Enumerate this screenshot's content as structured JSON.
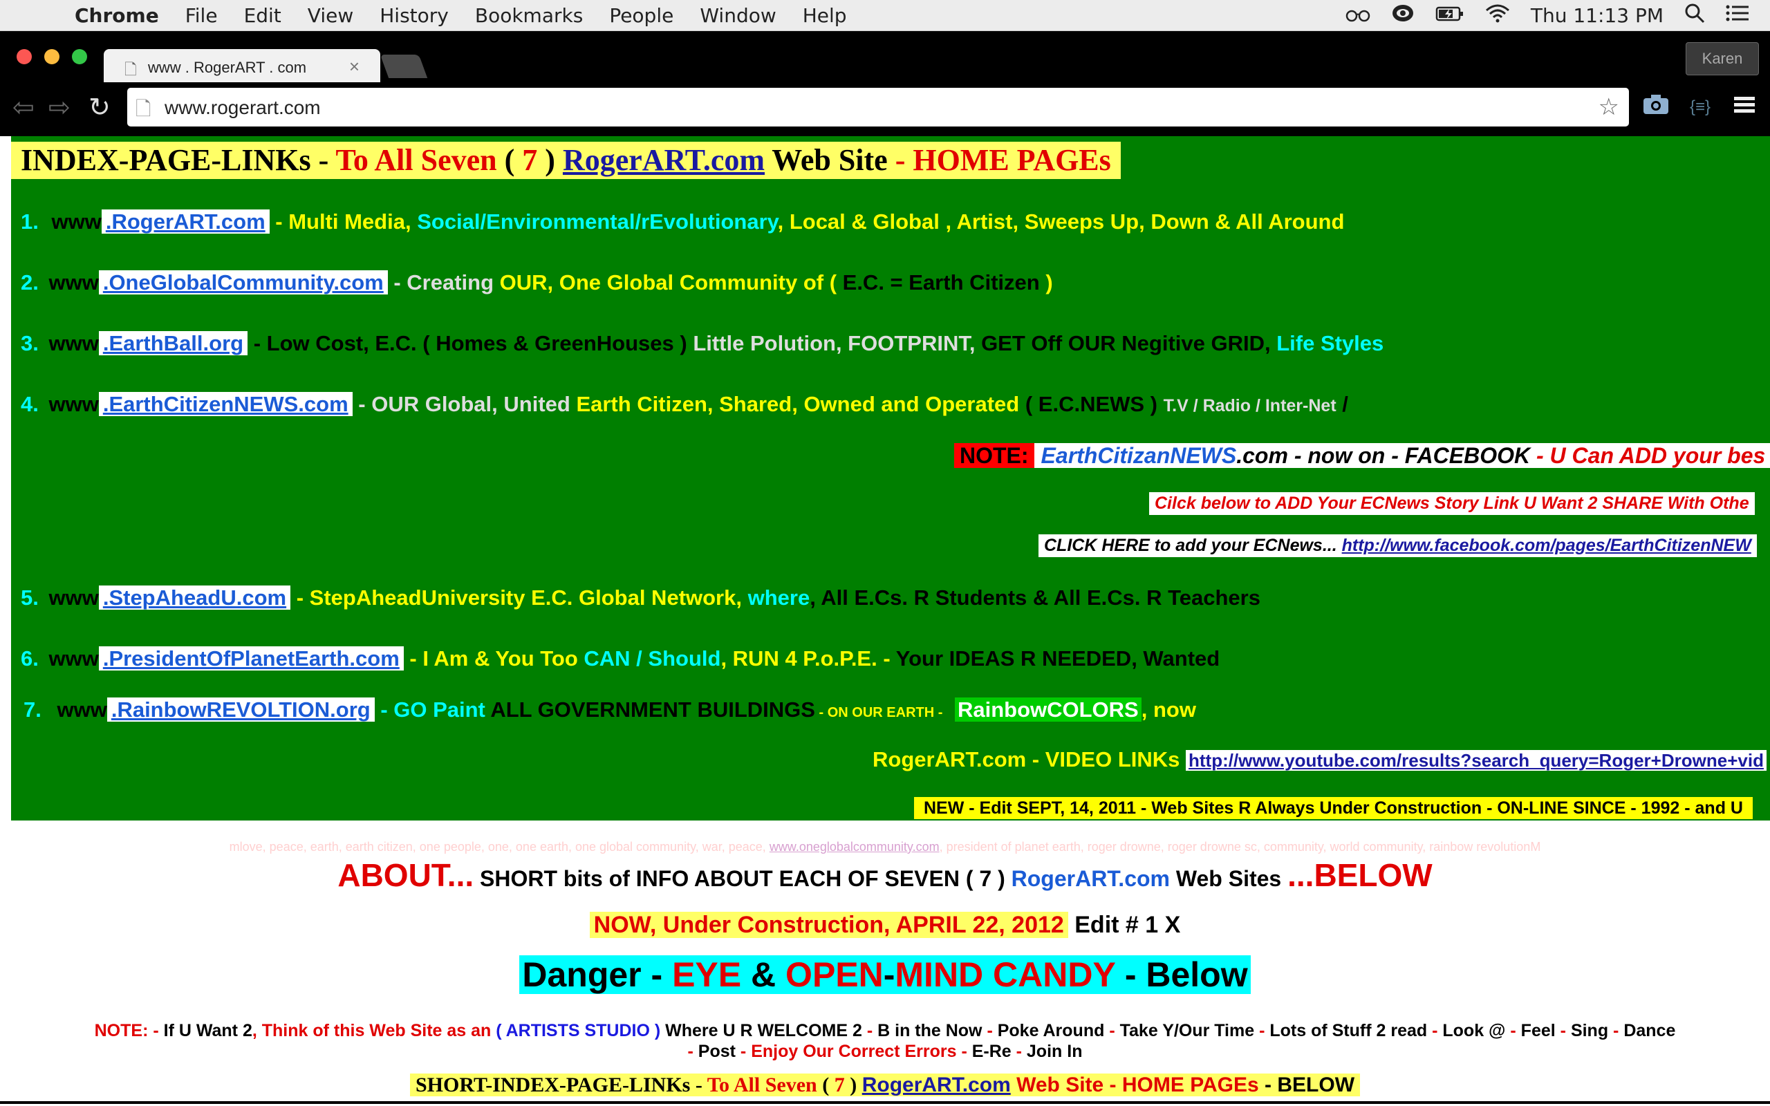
{
  "menubar": {
    "app": "Chrome",
    "items": [
      "File",
      "Edit",
      "View",
      "History",
      "Bookmarks",
      "People",
      "Window",
      "Help"
    ],
    "clock": "Thu 11:13 PM",
    "icons": [
      "apple-icon",
      "glasses-icon",
      "eye-circle-icon",
      "battery-charging-icon",
      "wifi-icon",
      "search-icon",
      "list-icon"
    ]
  },
  "browser": {
    "tab_title": "www . RogerART . com",
    "profile": "Karen",
    "url": "www.rogerart.com"
  },
  "page": {
    "banner": {
      "a": "INDEX-PAGE-LINKs",
      "b": " - ",
      "c": "To All Seven",
      "d": " ( ",
      "e": "7",
      "f": " ) ",
      "g": "RogerART.com",
      "h": " Web Site ",
      "i": "- HOME PAGEs"
    },
    "sites": [
      {
        "num": "1.",
        "www": "www",
        "link": ".RogerART.com",
        "desc": [
          " - Multi Media, ",
          "Social/Environmental/rEvolutionary",
          ", Local & Global , Artist, Sweeps Up, Down & All Around"
        ]
      },
      {
        "num": "2.",
        "www": "www",
        "link": ".OneGlobalCommunity.com",
        "desc": [
          " - Creating ",
          "OUR, One Global Community of ( ",
          "E.C. = Earth Citizen",
          " )"
        ]
      },
      {
        "num": "3.",
        "www": "www",
        "link": ".EarthBall.org",
        "desc": [
          " -  Low Cost, E.C. ( Homes & GreenHouses ) ",
          "Little Polution, FOOTPRINT, ",
          "GET Off OUR Negitive GRID, ",
          "Life Styles"
        ]
      },
      {
        "num": "4.",
        "www": "www",
        "link": ".EarthCitizenNEWS.com",
        "desc": [
          " - OUR Global, United ",
          "Earth Citizen, Shared, Owned and Operated",
          " ( E.C.NEWS ) ",
          "T.V / Radio / Inter-Net",
          " /"
        ]
      },
      {
        "num": "5.",
        "www": "www",
        "link": ".StepAheadU.com",
        "desc": [
          " - StepAheadUniversity ",
          "E.C. Global Network, ",
          "where",
          ", All E.Cs. R Students & All E.Cs. R Teachers"
        ]
      },
      {
        "num": "6.",
        "www": "www",
        "link": ".PresidentOfPlanetEarth.com",
        "desc": [
          " - I Am & You Too ",
          "CAN / Should",
          ", RUN 4 P.o.P.E. - ",
          "Your IDEAS R NEEDED, Wanted"
        ]
      },
      {
        "num": "7.",
        "www": "www",
        "link": ".RainbowREVOLTION.org",
        "desc": [
          " - GO Paint ",
          "ALL GOVERNMENT BUILDINGS",
          " - ON OUR EARTH - ",
          "RainbowCOLORS",
          ", now"
        ]
      }
    ],
    "note": {
      "label": "NOTE:",
      "a": "EarthCitizanNEWS",
      "b": ".com - now on - FACEBOOK ",
      "c": "- U Can ADD your bes"
    },
    "click_add": "Cilck below to ADD Your ECNews Story Link U Want 2 SHARE With Othe",
    "click_here": {
      "label": "CLICK HERE to add your ECNews...  ",
      "link": "http://www.facebook.com/pages/EarthCitizenNEW"
    },
    "video": {
      "label": "RogerART.com - VIDEO LINKs ",
      "link": "http://www.youtube.com/results?search_query=Roger+Drowne+vid"
    },
    "edit_bar": "NEW - Edit SEPT, 14, 2011 -  Web Sites R Always Under Construction - ON-LINE SINCE - 1992 - and U",
    "keywords": "mlove, peace, earth, earth citizen, one people, one, one earth, one global community, war, peace, ",
    "keywords_link": "www.oneglobalcommunity.com",
    "keywords_tail": ", president of planet earth, roger drowne, roger drowne sc, community, world community, rainbow revolutionM",
    "about": {
      "a": "ABOUT...",
      "b": " SHORT bits of INFO ABOUT EACH OF SEVEN  ( 7 ) ",
      "c": "RogerART.com",
      "d": " Web Sites ",
      "e": "...BELOW"
    },
    "construction": {
      "a": "NOW, Under Construction, APRIL 22, 2012",
      "b": " Edit # 1 X"
    },
    "danger": {
      "a": "Danger",
      "b": " - ",
      "c": "EYE",
      "d": " & ",
      "e": "OPEN",
      "f": "-",
      "g": "MIND CANDY",
      "h": " - Below"
    },
    "note2": {
      "line1": [
        "NOTE: - ",
        "If U Want 2",
        ", Think of this Web Site as an ",
        "( ARTISTS STUDIO )",
        " Where U R WELCOME 2 ",
        "- ",
        "B in the Now ",
        "- ",
        "Poke Around ",
        "- ",
        "Take Y/Our Time ",
        "- ",
        "Lots of Stuff 2 read ",
        "- ",
        "Look @ ",
        "- ",
        "Feel ",
        "- ",
        "Sing ",
        "- ",
        "Dance"
      ],
      "line2": [
        "- ",
        "Post ",
        "- Enjoy Our Correct Errors - ",
        "E-Re ",
        "- ",
        "Join In"
      ]
    },
    "short_index": {
      "a": "SHORT-INDEX-PAGE-LINKs",
      "b": " - ",
      "c": "To All Seven",
      "d": " ( ",
      "e": "7",
      "f": " ) ",
      "g": "RogerART.com",
      "h": " Web Site - HOME PAGEs",
      "i": " - BELOW"
    }
  },
  "colors": {
    "page_green": "#007f00",
    "banner_yellow": "#ffff66",
    "link_blue": "#1a5bd6",
    "red": "#e00000",
    "cyan": "#00ffff"
  }
}
